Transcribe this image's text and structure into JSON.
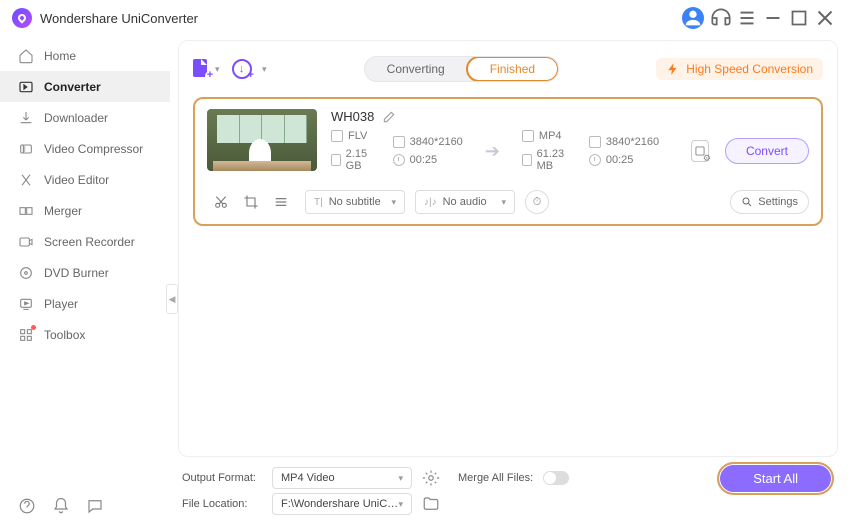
{
  "app": {
    "title": "Wondershare UniConverter"
  },
  "sidebar": {
    "items": [
      {
        "label": "Home"
      },
      {
        "label": "Converter"
      },
      {
        "label": "Downloader"
      },
      {
        "label": "Video Compressor"
      },
      {
        "label": "Video Editor"
      },
      {
        "label": "Merger"
      },
      {
        "label": "Screen Recorder"
      },
      {
        "label": "DVD Burner"
      },
      {
        "label": "Player"
      },
      {
        "label": "Toolbox"
      }
    ]
  },
  "tabs": {
    "converting": "Converting",
    "finished": "Finished"
  },
  "highspeed": {
    "label": "High Speed Conversion"
  },
  "file": {
    "name": "WH038",
    "in_format": "FLV",
    "in_res": "3840*2160",
    "in_size": "2.15 GB",
    "in_dur": "00:25",
    "out_format": "MP4",
    "out_res": "3840*2160",
    "out_size": "61.23 MB",
    "out_dur": "00:25",
    "convert": "Convert",
    "subtitle": "No subtitle",
    "audio": "No audio",
    "settings": "Settings"
  },
  "footer": {
    "output_label": "Output Format:",
    "output_value": "MP4 Video",
    "location_label": "File Location:",
    "location_value": "F:\\Wondershare UniConverter",
    "merge_label": "Merge All Files:",
    "start_all": "Start All"
  }
}
